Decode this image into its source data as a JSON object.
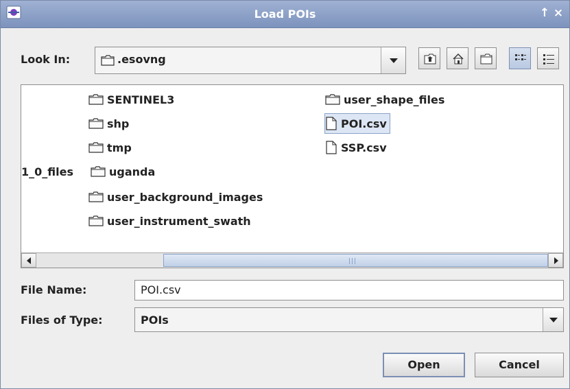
{
  "window": {
    "title": "Load POIs",
    "maximize_glyph": "↑",
    "close_glyph": "×"
  },
  "look_in": {
    "label": "Look In:",
    "value": ".esovng"
  },
  "toolbar": {
    "buttons": [
      "up-one-level",
      "home",
      "new-folder",
      "list-view",
      "details-view"
    ]
  },
  "files": [
    {
      "name": "SENTINEL3",
      "type": "folder"
    },
    {
      "name": "shp",
      "type": "folder"
    },
    {
      "name": "tmp",
      "type": "folder"
    },
    {
      "name": "uganda",
      "type": "folder",
      "prefix_fragment": "1_0_files"
    },
    {
      "name": "user_background_images",
      "type": "folder"
    },
    {
      "name": "user_instrument_swath",
      "type": "folder"
    },
    {
      "name": "user_shape_files",
      "type": "folder"
    },
    {
      "name": "POI.csv",
      "type": "file",
      "selected": true
    },
    {
      "name": "SSP.csv",
      "type": "file"
    }
  ],
  "file_name": {
    "label": "File Name:",
    "value": "POI.csv"
  },
  "files_of_type": {
    "label": "Files of Type:",
    "value": "POIs"
  },
  "actions": {
    "open_label": "Open",
    "cancel_label": "Cancel"
  },
  "colors": {
    "titlebar": "#8ba0c7",
    "selection": "#dde6f4"
  }
}
